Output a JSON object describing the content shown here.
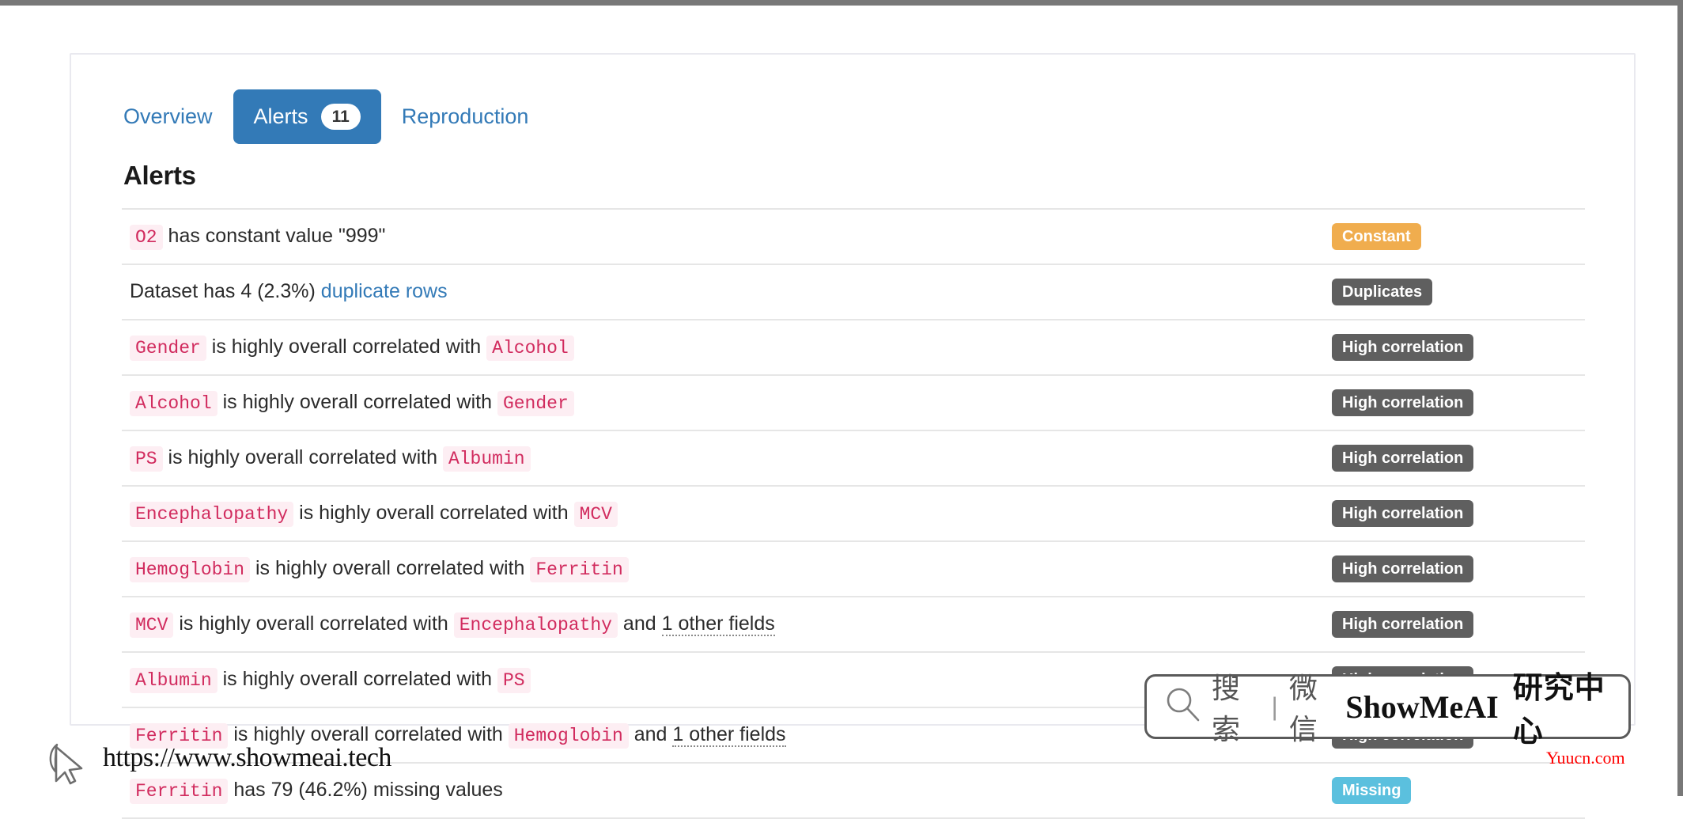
{
  "tabs": [
    {
      "label": "Overview",
      "active": false,
      "badge": null
    },
    {
      "label": "Alerts",
      "active": true,
      "badge": "11"
    },
    {
      "label": "Reproduction",
      "active": false,
      "badge": null
    }
  ],
  "section": {
    "title": "Alerts"
  },
  "alerts": [
    {
      "parts": [
        {
          "type": "var",
          "text": "O2"
        },
        {
          "type": "text",
          "text": " has constant value \"999\""
        }
      ],
      "badge": {
        "label": "Constant",
        "kind": "constant",
        "color": "#f0ad4e"
      }
    },
    {
      "parts": [
        {
          "type": "text",
          "text": "Dataset has 4 (2.3%) "
        },
        {
          "type": "link",
          "text": "duplicate rows"
        }
      ],
      "badge": {
        "label": "Duplicates",
        "kind": "duplicates",
        "color": "#5f5f5f"
      }
    },
    {
      "parts": [
        {
          "type": "var",
          "text": "Gender"
        },
        {
          "type": "text",
          "text": " is highly overall correlated with "
        },
        {
          "type": "var",
          "text": "Alcohol"
        }
      ],
      "badge": {
        "label": "High correlation",
        "kind": "corr",
        "color": "#5f5f5f"
      }
    },
    {
      "parts": [
        {
          "type": "var",
          "text": "Alcohol"
        },
        {
          "type": "text",
          "text": " is highly overall correlated with "
        },
        {
          "type": "var",
          "text": "Gender"
        }
      ],
      "badge": {
        "label": "High correlation",
        "kind": "corr",
        "color": "#5f5f5f"
      }
    },
    {
      "parts": [
        {
          "type": "var",
          "text": "PS"
        },
        {
          "type": "text",
          "text": " is highly overall correlated with "
        },
        {
          "type": "var",
          "text": "Albumin"
        }
      ],
      "badge": {
        "label": "High correlation",
        "kind": "corr",
        "color": "#5f5f5f"
      }
    },
    {
      "parts": [
        {
          "type": "var",
          "text": "Encephalopathy"
        },
        {
          "type": "text",
          "text": " is highly overall correlated with "
        },
        {
          "type": "var",
          "text": "MCV"
        }
      ],
      "badge": {
        "label": "High correlation",
        "kind": "corr",
        "color": "#5f5f5f"
      }
    },
    {
      "parts": [
        {
          "type": "var",
          "text": "Hemoglobin"
        },
        {
          "type": "text",
          "text": " is highly overall correlated with "
        },
        {
          "type": "var",
          "text": "Ferritin"
        }
      ],
      "badge": {
        "label": "High correlation",
        "kind": "corr",
        "color": "#5f5f5f"
      }
    },
    {
      "parts": [
        {
          "type": "var",
          "text": "MCV"
        },
        {
          "type": "text",
          "text": " is highly overall correlated with "
        },
        {
          "type": "var",
          "text": "Encephalopathy"
        },
        {
          "type": "text",
          "text": " and "
        },
        {
          "type": "abbr",
          "text": "1 other fields"
        }
      ],
      "badge": {
        "label": "High correlation",
        "kind": "corr",
        "color": "#5f5f5f"
      }
    },
    {
      "parts": [
        {
          "type": "var",
          "text": "Albumin"
        },
        {
          "type": "text",
          "text": " is highly overall correlated with "
        },
        {
          "type": "var",
          "text": "PS"
        }
      ],
      "badge": {
        "label": "High correlation",
        "kind": "corr",
        "color": "#5f5f5f"
      }
    },
    {
      "parts": [
        {
          "type": "var",
          "text": "Ferritin"
        },
        {
          "type": "text",
          "text": " is highly overall correlated with "
        },
        {
          "type": "var",
          "text": "Hemoglobin"
        },
        {
          "type": "text",
          "text": " and "
        },
        {
          "type": "abbr",
          "text": "1 other fields"
        }
      ],
      "badge": {
        "label": "High correlation",
        "kind": "corr",
        "color": "#5f5f5f"
      }
    },
    {
      "parts": [
        {
          "type": "var",
          "text": "Ferritin"
        },
        {
          "type": "text",
          "text": " has 79 (46.2%) missing values"
        }
      ],
      "badge": {
        "label": "Missing",
        "kind": "missing",
        "color": "#5bc0de"
      }
    }
  ],
  "watermark": {
    "icon": "search-icon",
    "search_label": "搜索",
    "separator": "|",
    "channel_label": "微信",
    "brand": "ShowMeAI",
    "brand_cn": "研究中心"
  },
  "footer": {
    "cursor_icon": "cursor-arrow-icon",
    "url": "https://www.showmeai.tech",
    "corner_tag": "Yuucn.com"
  },
  "colors": {
    "accent_blue": "#337ab7",
    "var_text": "#d12b5e",
    "var_bg": "#fdeef3",
    "warn_orange": "#f0ad4e",
    "neutral_gray": "#5f5f5f",
    "info_blue": "#5bc0de"
  }
}
